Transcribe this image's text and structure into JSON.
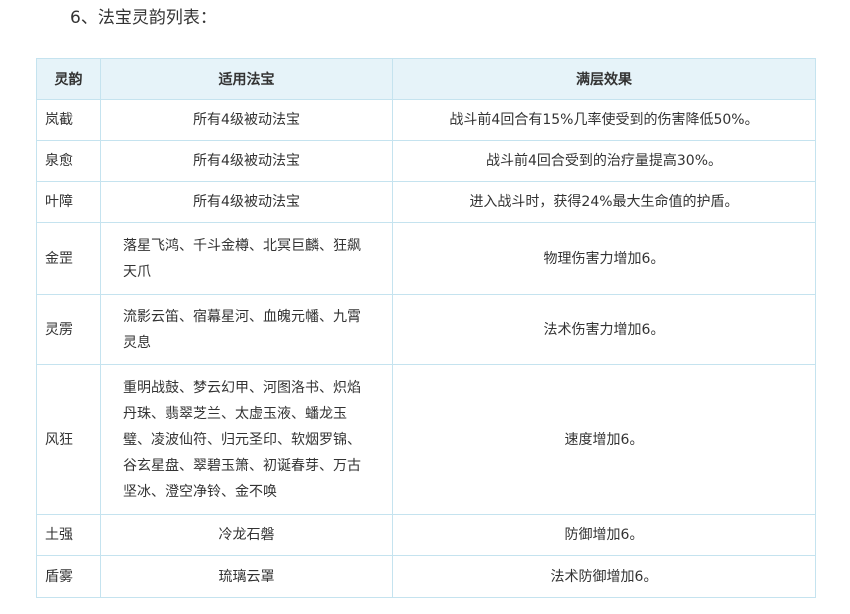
{
  "heading": "6、法宝灵韵列表：",
  "table": {
    "headers": [
      "灵韵",
      "适用法宝",
      "满层效果"
    ],
    "rows": [
      {
        "name": "岚截",
        "treasure": "所有4级被动法宝",
        "effect": "战斗前4回合有15%几率使受到的伤害降低50%。"
      },
      {
        "name": "泉愈",
        "treasure": "所有4级被动法宝",
        "effect": "战斗前4回合受到的治疗量提高30%。"
      },
      {
        "name": "叶障",
        "treasure": "所有4级被动法宝",
        "effect": "进入战斗时，获得24%最大生命值的护盾。"
      },
      {
        "name": "金罡",
        "treasure": "落星飞鸿、千斗金樽、北冥巨麟、狂飙天爪",
        "effect": "物理伤害力增加6。"
      },
      {
        "name": "灵雳",
        "treasure": "流影云笛、宿幕星河、血魄元幡、九霄灵息",
        "effect": "法术伤害力增加6。"
      },
      {
        "name": "风狂",
        "treasure": "重明战鼓、梦云幻甲、河图洛书、炽焰丹珠、翡翠芝兰、太虚玉液、蟠龙玉璧、凌波仙符、归元圣印、软烟罗锦、谷玄星盘、翠碧玉箫、初诞春芽、万古坚冰、澄空净铃、金不唤",
        "effect": "速度增加6。"
      },
      {
        "name": "土强",
        "treasure": "冷龙石磐",
        "effect": "防御增加6。"
      },
      {
        "name": "盾雾",
        "treasure": "琉璃云罩",
        "effect": "法术防御增加6。"
      }
    ]
  }
}
